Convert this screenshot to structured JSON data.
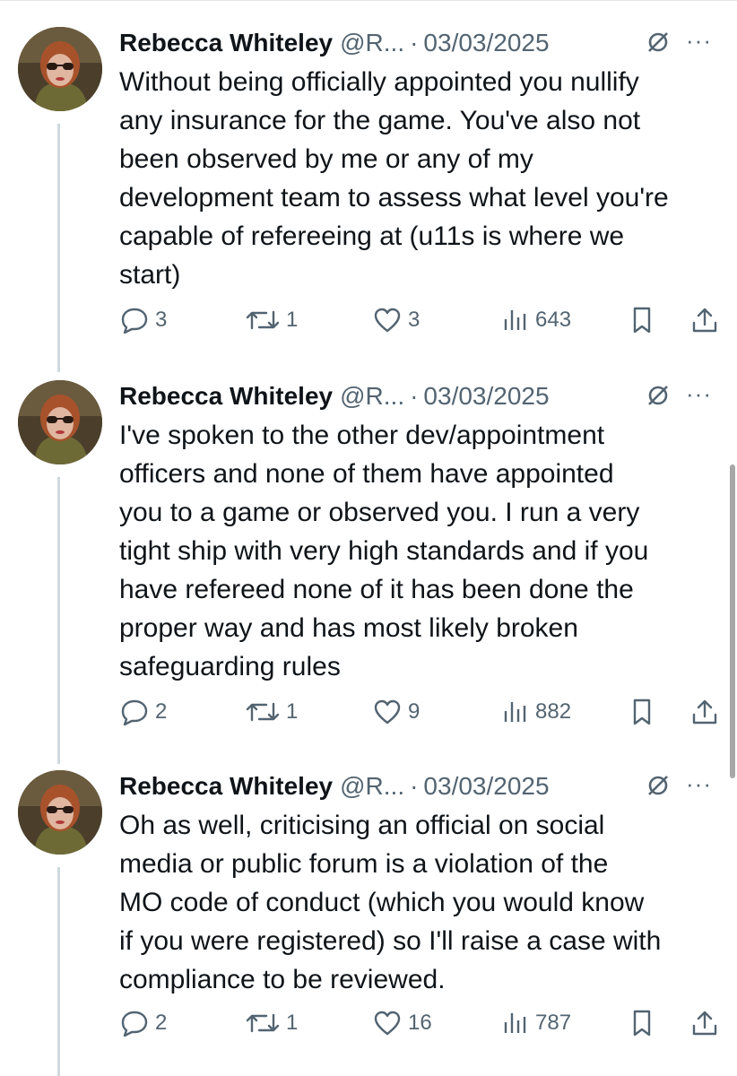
{
  "tweets": [
    {
      "author": "Rebecca Whiteley",
      "handle": "@R...",
      "separator": "·",
      "date": "03/03/2025",
      "more": "···",
      "lines": [
        "Without being officially appointed you nullify",
        "any insurance for the game. You've also not",
        "been observed by me or any of my",
        "development team to assess what level you're",
        "capable of refereeing at (u11s is where we",
        "start)"
      ],
      "replies": "3",
      "reposts": "1",
      "likes": "3",
      "views": "643"
    },
    {
      "author": "Rebecca Whiteley",
      "handle": "@R...",
      "separator": "·",
      "date": "03/03/2025",
      "more": "···",
      "lines": [
        "I've spoken to the other dev/appointment",
        "officers and none of them have appointed",
        "you to a game or observed you. I run a very",
        "tight ship with very high standards and if you",
        "have refereed none of it has been done the",
        "proper way and has most likely broken",
        "safeguarding rules"
      ],
      "replies": "2",
      "reposts": "1",
      "likes": "9",
      "views": "882"
    },
    {
      "author": "Rebecca Whiteley",
      "handle": "@R...",
      "separator": "·",
      "date": "03/03/2025",
      "more": "···",
      "lines": [
        "Oh as well, criticising an official on social",
        "media or public forum is a violation of the",
        "MO code of conduct (which you would know",
        "if you were registered) so I'll raise a case with",
        "compliance to be reviewed."
      ],
      "replies": "2",
      "reposts": "1",
      "likes": "16",
      "views": "787"
    }
  ],
  "colors": {
    "text": "#0f1419",
    "muted": "#536471",
    "thread_line": "#cfd9de"
  },
  "icons": [
    "reply-icon",
    "repost-icon",
    "like-icon",
    "views-icon",
    "bookmark-icon",
    "share-icon",
    "no-entry-icon"
  ]
}
